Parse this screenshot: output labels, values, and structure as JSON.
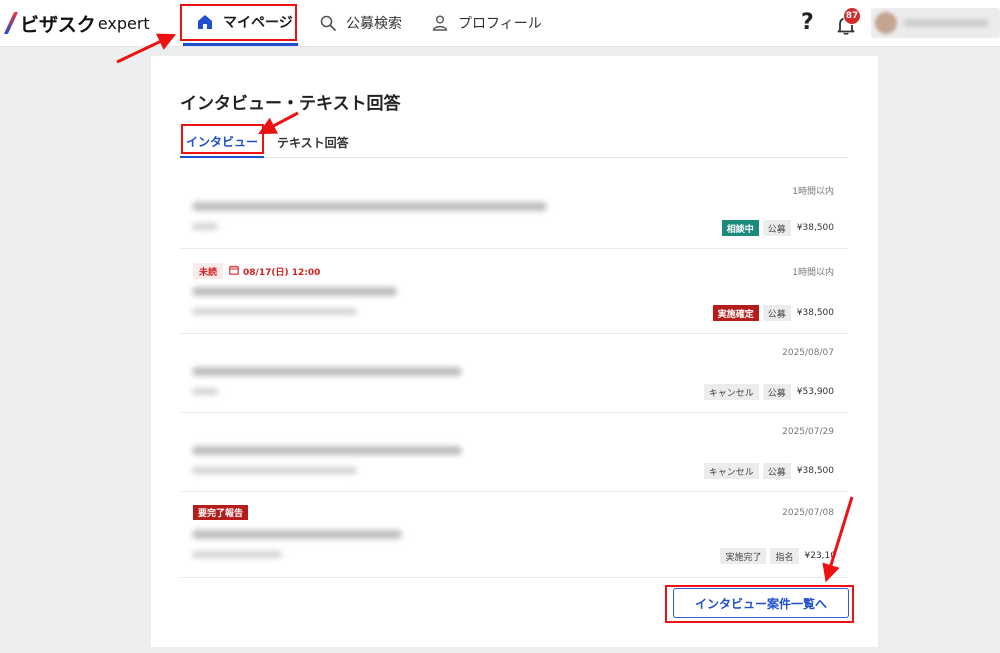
{
  "header": {
    "logo_main": "ビザスク",
    "logo_sub": "expert",
    "nav": [
      {
        "label": "マイページ",
        "icon": "home-icon"
      },
      {
        "label": "公募検索",
        "icon": "search-icon"
      },
      {
        "label": "プロフィール",
        "icon": "person-icon"
      }
    ],
    "help_label": "?",
    "notification_count": "87"
  },
  "main": {
    "title": "インタビュー・テキスト回答",
    "tabs": [
      {
        "label": "インタビュー",
        "active": true
      },
      {
        "label": "テキスト回答",
        "active": false
      }
    ],
    "items": [
      {
        "time": "1時間以内",
        "status": "相談中",
        "type": "公募",
        "price": "¥38,500"
      },
      {
        "unread": "未読",
        "schedule": "08/17(日) 12:00",
        "time": "1時間以内",
        "status": "実施確定",
        "type": "公募",
        "price": "¥38,500"
      },
      {
        "time": "2025/08/07",
        "status": "キャンセル",
        "type": "公募",
        "price": "¥53,900"
      },
      {
        "time": "2025/07/29",
        "status": "キャンセル",
        "type": "公募",
        "price": "¥38,500"
      },
      {
        "label": "要完了報告",
        "time": "2025/07/08",
        "status": "実施完了",
        "type": "指名",
        "price": "¥23,10"
      }
    ],
    "more_button": "インタビュー案件一覧へ"
  },
  "colors": {
    "accent": "#1f4fcf",
    "status_green": "#1a8a7c",
    "status_red": "#b51c1c",
    "annotation": "#e11111"
  }
}
